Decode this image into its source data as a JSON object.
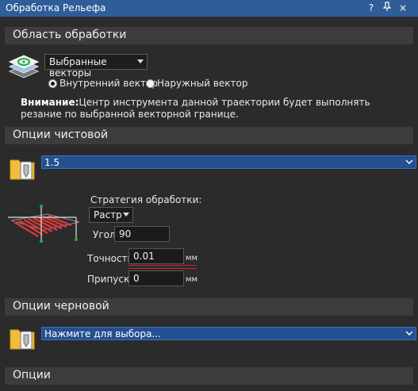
{
  "window": {
    "title": "Обработка Рельефа",
    "buttons": [
      "?",
      "ᵽ",
      "×"
    ]
  },
  "area": {
    "header": "Область обработки",
    "vector_select": "Выбранные векторы",
    "radio_inner": "Внутренний вектор",
    "radio_outer": "Наружный вектор",
    "note_bold": "Внимание:",
    "note_text": "Центр инструмента данной траектории будет выполнять резание по выбранной векторной границе."
  },
  "finish": {
    "header": "Опции чистовой",
    "tool": "1.5",
    "strategy_label": "Стратегия обработки:",
    "strategy_value": "Растр",
    "angle_label": "Угол:",
    "angle_value": "90",
    "tolerance_label": "Точность:",
    "tolerance_value": "0.01",
    "tolerance_unit": "мм",
    "allowance_label": "Припуск:",
    "allowance_value": "0",
    "allowance_unit": "мм"
  },
  "rough": {
    "header": "Опции черновой",
    "tool_placeholder": "Нажмите для выбора..."
  },
  "options": {
    "header": "Опции"
  }
}
